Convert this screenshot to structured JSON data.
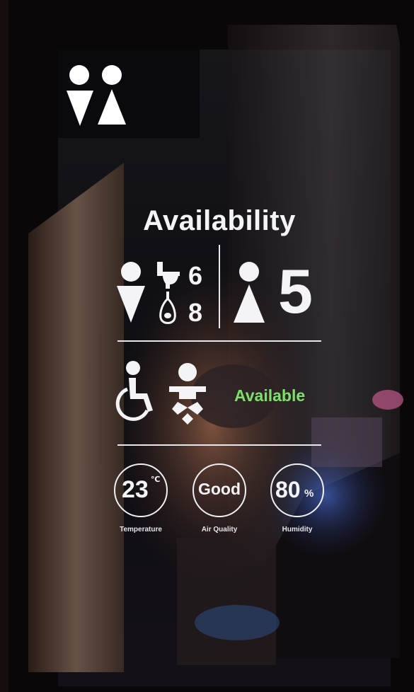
{
  "sign": {
    "title": "Availability",
    "female_stalls": "6",
    "urinals": "8",
    "male_stalls": "5",
    "accessible_status": "Available",
    "status_color": "#7ee06a",
    "gauges": [
      {
        "value": "23",
        "unit": "℃",
        "label": "Temperature"
      },
      {
        "value": "Good",
        "unit": "",
        "label": "Air Quality"
      },
      {
        "value": "80",
        "unit": "%",
        "label": "Humidity"
      }
    ],
    "icons": [
      "restroom-icon",
      "female-icon",
      "toilet-icon",
      "urinal-icon",
      "male-icon",
      "wheelchair-icon",
      "baby-changing-icon"
    ]
  }
}
